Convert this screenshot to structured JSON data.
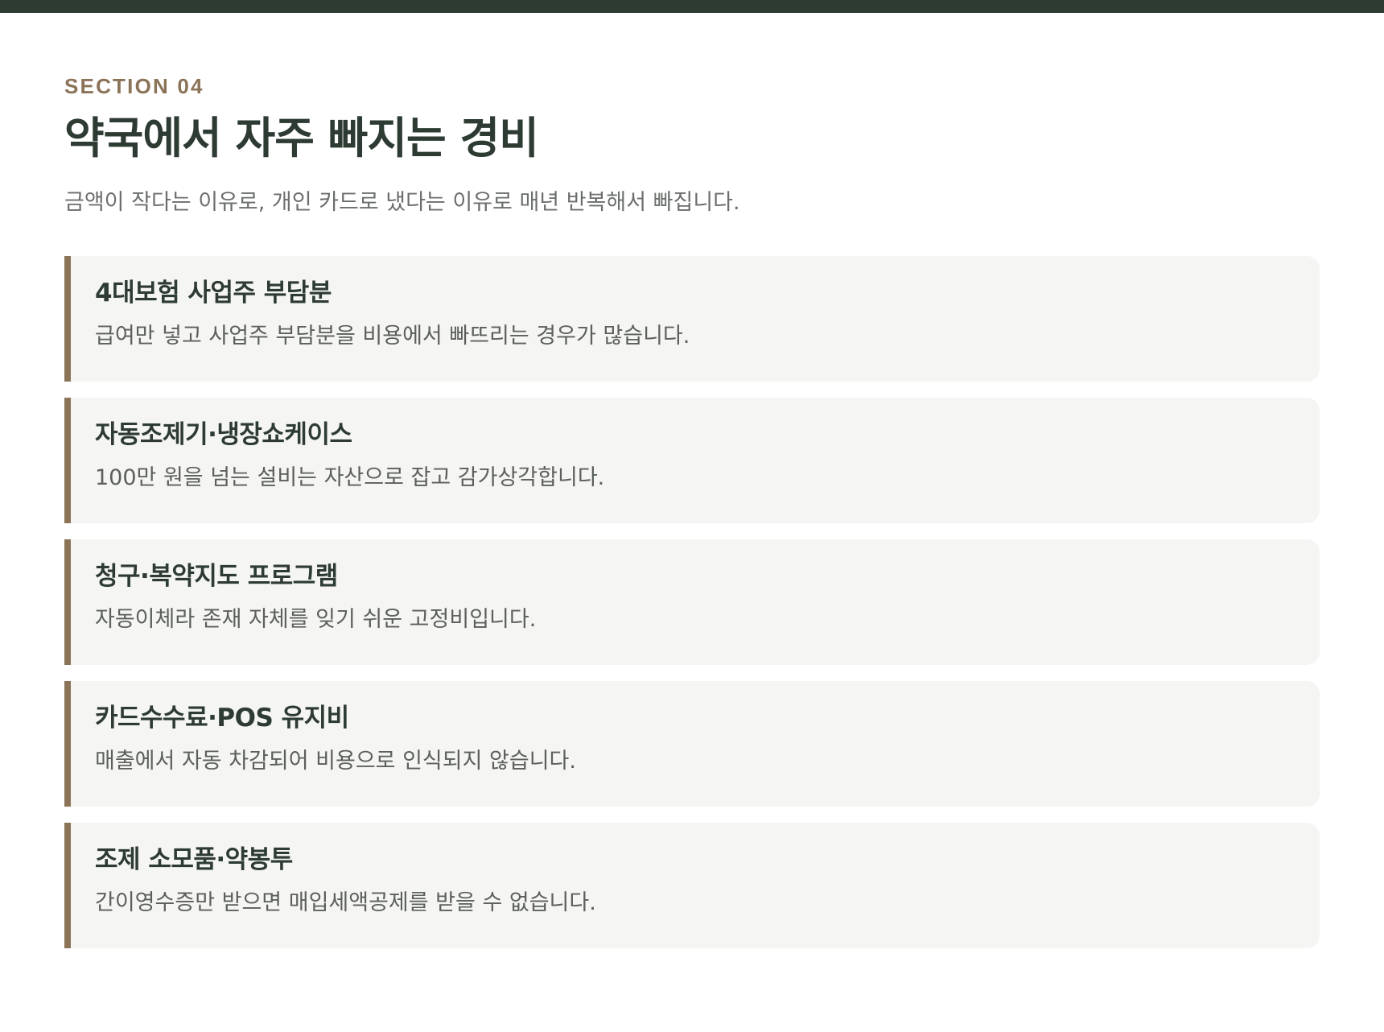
{
  "header": {
    "eyebrow": "SECTION 04",
    "title": "약국에서 자주 빠지는 경비",
    "lead": "금액이 작다는 이유로, 개인 카드로 냈다는 이유로 매년 반복해서 빠집니다."
  },
  "cards": [
    {
      "title": "4대보험 사업주 부담분",
      "desc": "급여만 넣고 사업주 부담분을 비용에서 빠뜨리는 경우가 많습니다."
    },
    {
      "title": "자동조제기·냉장쇼케이스",
      "desc": "100만 원을 넘는 설비는 자산으로 잡고 감가상각합니다."
    },
    {
      "title": "청구·복약지도 프로그램",
      "desc": "자동이체라 존재 자체를 잊기 쉬운 고정비입니다."
    },
    {
      "title": "카드수수료·POS 유지비",
      "desc": "매출에서 자동 차감되어 비용으로 인식되지 않습니다."
    },
    {
      "title": "조제 소모품·약봉투",
      "desc": "간이영수증만 받으면 매입세액공제를 받을 수 없습니다."
    }
  ],
  "colors": {
    "top_bar": "#2d3b33",
    "accent": "#8b7358",
    "card_background": "#f5f5f3"
  }
}
